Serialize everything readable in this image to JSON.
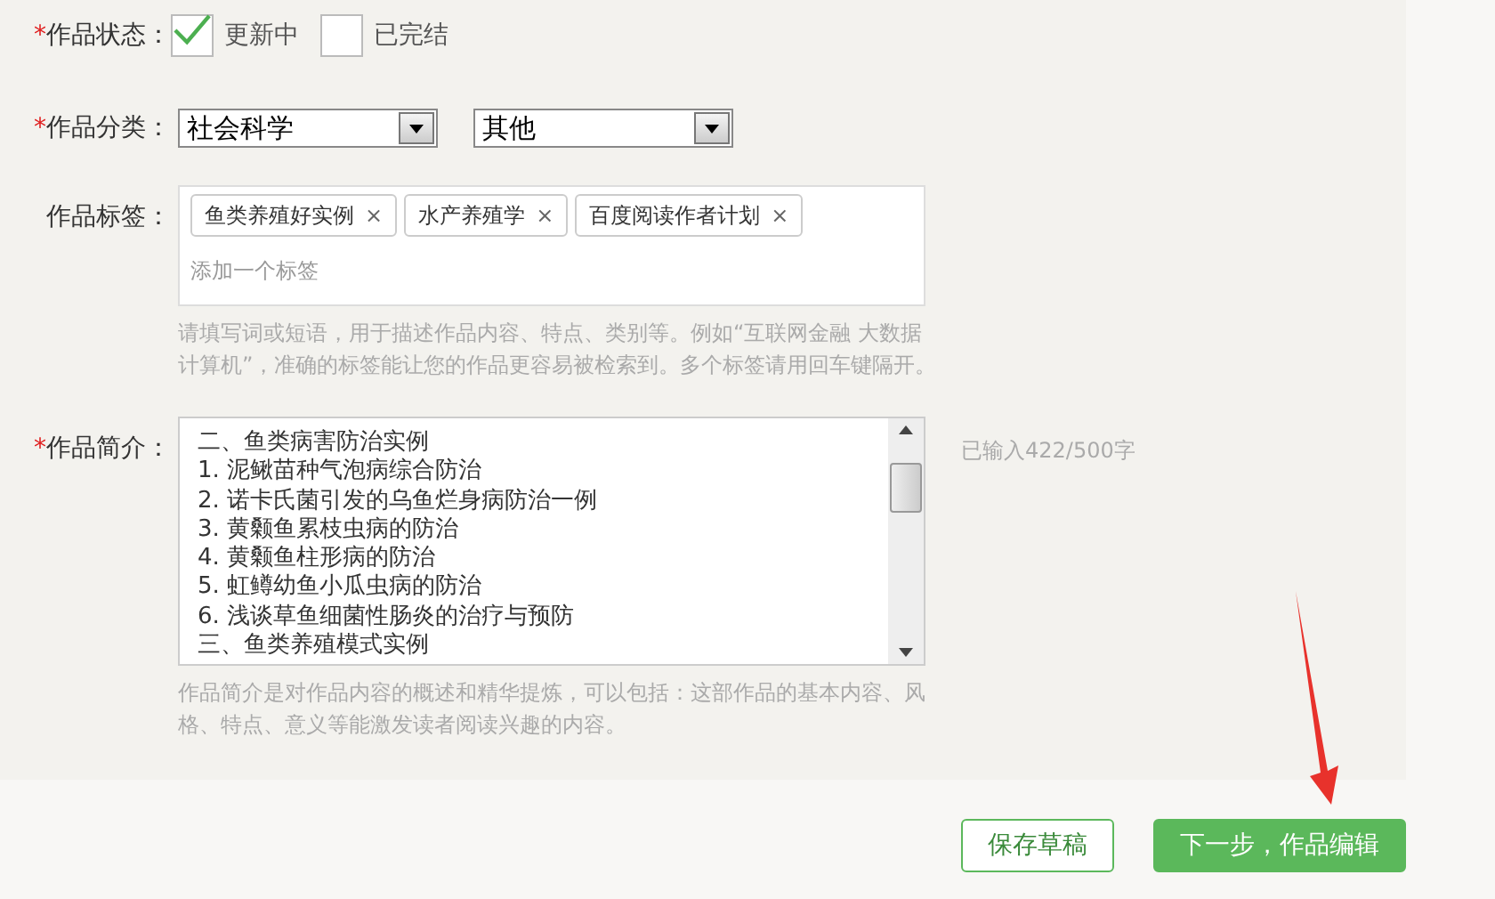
{
  "status": {
    "label": "作品状态：",
    "required_mark": "*",
    "options": [
      {
        "label": "更新中",
        "checked": true
      },
      {
        "label": "已完结",
        "checked": false
      }
    ]
  },
  "category": {
    "label": "作品分类：",
    "required_mark": "*",
    "selects": [
      {
        "value": "社会科学"
      },
      {
        "value": "其他"
      }
    ]
  },
  "tags": {
    "label": "作品标签：",
    "items": [
      {
        "label": "鱼类养殖好实例",
        "remove": "×"
      },
      {
        "label": "水产养殖学",
        "remove": "×"
      },
      {
        "label": "百度阅读作者计划",
        "remove": "×"
      }
    ],
    "placeholder": "添加一个标签",
    "hint": "请填写词或短语，用于描述作品内容、特点、类别等。例如“互联网金融 大数据计算机”，准确的标签能让您的作品更容易被检索到。多个标签请用回车键隔开。"
  },
  "intro": {
    "label": "作品简介：",
    "required_mark": "*",
    "lines": [
      "二、鱼类病害防治实例",
      "1. 泥鳅苗种气泡病综合防治",
      "2. 诺卡氏菌引发的乌鱼烂身病防治一例",
      "3. 黄颡鱼累枝虫病的防治",
      "4. 黄颡鱼柱形病的防治",
      "5. 虹鳟幼鱼小瓜虫病的防治",
      "6. 浅谈草鱼细菌性肠炎的治疗与预防",
      "三、鱼类养殖模式实例"
    ],
    "counter": "已输入422/500字",
    "hint": "作品简介是对作品内容的概述和精华提炼，可以包括：这部作品的基本内容、风格、特点、意义等能激发读者阅读兴趣的内容。"
  },
  "buttons": [
    {
      "label": "保存草稿",
      "kind": "outline"
    },
    {
      "label": "下一步，作品编辑",
      "kind": "primary"
    }
  ]
}
